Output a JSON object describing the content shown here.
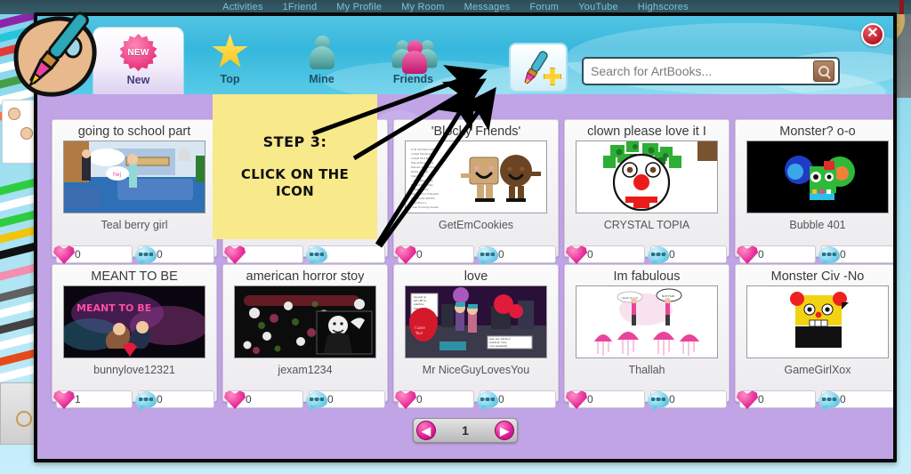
{
  "top_nav": {
    "items": [
      "Activities",
      "1Friend",
      "My Profile",
      "My Room",
      "Messages",
      "Forum",
      "YouTube",
      "Highscores"
    ]
  },
  "window": {
    "close_label": "✕",
    "logo_name": "artbook-palette-logo"
  },
  "tabs": [
    {
      "label": "New",
      "icon": "new-badge-icon",
      "active": true
    },
    {
      "label": "Top",
      "icon": "star-icon",
      "active": false
    },
    {
      "label": "Mine",
      "icon": "single-person-icon",
      "active": false
    },
    {
      "label": "Friends",
      "icon": "group-people-icon",
      "active": false
    }
  ],
  "create_button": {
    "name": "create-artbook-button",
    "icon": "paintbrush-plus-icon"
  },
  "search": {
    "placeholder": "Search for ArtBooks...",
    "value": "",
    "button_icon": "search-icon"
  },
  "overlay_note": {
    "line1": "STEP 3:",
    "line2": "CLICK ON THE ICON",
    "arrow_count": 4
  },
  "cards": [
    {
      "title": "going to school part",
      "author": "Teal berry girl",
      "likes": "0",
      "comments": "0",
      "art": "school"
    },
    {
      "title": "",
      "author": "",
      "likes": "",
      "comments": "",
      "art": "hidden"
    },
    {
      "title": "'Blocky Friends'",
      "author": "GetEmCookies",
      "likes": "0",
      "comments": "0",
      "art": "blocky"
    },
    {
      "title": "clown please love it I",
      "author": "CRYSTAL TOPIA",
      "likes": "0",
      "comments": "0",
      "art": "clown"
    },
    {
      "title": "Monster? o-o",
      "author": "Bubble 401",
      "likes": "0",
      "comments": "0",
      "art": "monster"
    },
    {
      "title": "MEANT TO BE",
      "author": "bunnylove12321",
      "likes": "1",
      "comments": "0",
      "art": "meant"
    },
    {
      "title": "american horror stoy",
      "author": "jexam1234",
      "likes": "0",
      "comments": "0",
      "art": "horror"
    },
    {
      "title": "love",
      "author": "Mr NiceGuyLovesYou",
      "likes": "0",
      "comments": "0",
      "art": "love"
    },
    {
      "title": "Im fabulous",
      "author": "Thallah",
      "likes": "0",
      "comments": "0",
      "art": "fabulous"
    },
    {
      "title": "Monster Civ -No",
      "author": "GameGirlXox",
      "likes": "0",
      "comments": "0",
      "art": "civ"
    }
  ],
  "pagination": {
    "prev_label": "◀",
    "page": "1",
    "next_label": "▶"
  },
  "colors": {
    "modal_bg": "#c0a4e6",
    "header_blue": "#36b7dd",
    "accent_pink": "#e8309a",
    "note_yellow": "#f8e98a",
    "close_red": "#c41f2c"
  }
}
